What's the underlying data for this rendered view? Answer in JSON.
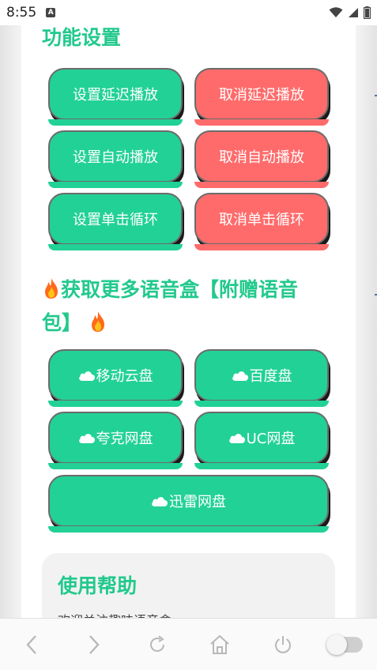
{
  "status_bar": {
    "time": "8:55",
    "notif_icon_letter": "A"
  },
  "sections": {
    "function_settings_title": "功能设置",
    "get_more_title": "获取更多语音盒【附赠语音包】"
  },
  "buttons": {
    "set_delay": "设置延迟播放",
    "cancel_delay": "取消延迟播放",
    "set_auto": "设置自动播放",
    "cancel_auto": "取消自动播放",
    "set_loop": "设置单击循环",
    "cancel_loop": "取消单击循环",
    "mobile_cloud": "移动云盘",
    "baidu": "百度盘",
    "quark": "夸克网盘",
    "uc": "UC网盘",
    "xunlei": "迅雷网盘"
  },
  "help": {
    "title": "使用帮助",
    "text": "欢迎关注趣味语音盒"
  },
  "colors": {
    "green": "#22d196",
    "red": "#ff6b6b",
    "title_green": "#22c98d"
  },
  "icons": {
    "fire": "fire-icon",
    "cloud": "cloud-icon",
    "back": "back-icon",
    "forward": "forward-icon",
    "reload": "reload-icon",
    "home": "home-icon",
    "power": "power-icon",
    "toggle": "toggle-switch"
  }
}
